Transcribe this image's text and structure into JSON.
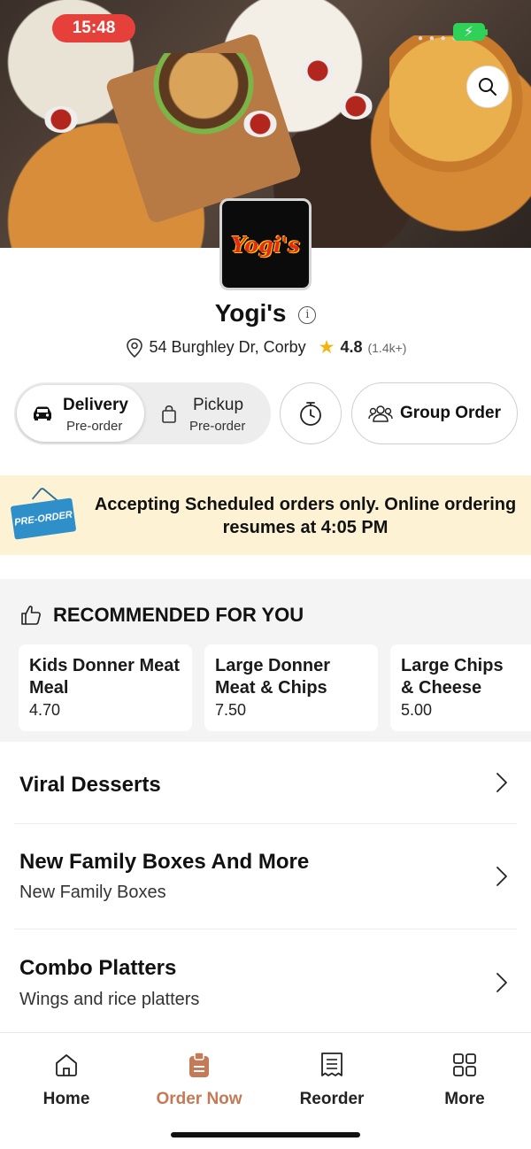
{
  "status_bar": {
    "time": "15:48"
  },
  "header": {
    "search_icon": "search-icon"
  },
  "store": {
    "logo_text": "Yogi's",
    "name": "Yogi's",
    "address": "54 Burghley Dr, Corby",
    "rating": "4.8",
    "rating_count": "(1.4k+)"
  },
  "order_mode": {
    "delivery": {
      "label": "Delivery",
      "sub": "Pre-order",
      "selected": true
    },
    "pickup": {
      "label": "Pickup",
      "sub": "Pre-order",
      "selected": false
    },
    "group_order_label": "Group Order"
  },
  "banner": {
    "sign_text": "PRE-ORDER",
    "message": "Accepting Scheduled orders only. Online ordering resumes at 4:05 PM"
  },
  "recommended": {
    "title": "RECOMMENDED FOR YOU",
    "items": [
      {
        "name": "Kids Donner Meat Meal",
        "price": "4.70"
      },
      {
        "name": "Large Donner Meat & Chips",
        "price": "7.50"
      },
      {
        "name": "Large Chips & Cheese",
        "price": "5.00"
      }
    ]
  },
  "categories": [
    {
      "title": "Viral Desserts",
      "subtitle": ""
    },
    {
      "title": "New Family Boxes And More",
      "subtitle": "New Family Boxes"
    },
    {
      "title": "Combo Platters",
      "subtitle": "Wings and rice platters"
    }
  ],
  "bottom_nav": {
    "items": [
      {
        "label": "Home",
        "icon": "home-icon",
        "active": false
      },
      {
        "label": "Order Now",
        "icon": "order-icon",
        "active": true
      },
      {
        "label": "Reorder",
        "icon": "receipt-icon",
        "active": false
      },
      {
        "label": "More",
        "icon": "grid-icon",
        "active": false
      }
    ]
  },
  "colors": {
    "accent": "#c47a56",
    "status_time_bg": "#e5413a",
    "banner_bg": "#fdf3d4",
    "star": "#f2b40f"
  }
}
